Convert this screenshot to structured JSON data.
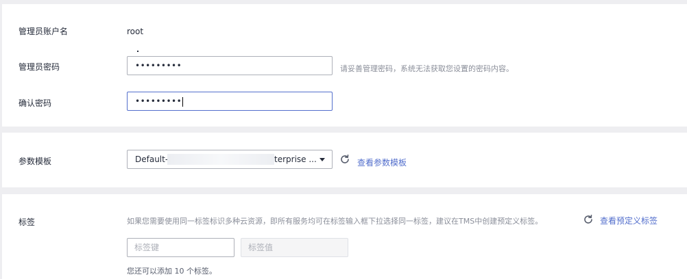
{
  "admin": {
    "account_label": "管理员账户名",
    "account_value": "root",
    "password_label": "管理员密码",
    "password_value": "•••••••••",
    "password_hint": "请妥善管理密码，系统无法获取您设置的密码内容。",
    "confirm_label": "确认密码",
    "confirm_value": "•••••••••"
  },
  "params": {
    "label": "参数模板",
    "selected_prefix": "Default-",
    "selected_suffix": "terprise ...",
    "refresh_icon": "refresh-icon",
    "view_link": "查看参数模板"
  },
  "tags": {
    "label": "标签",
    "hint": "如果您需要使用同一标签标识多种云资源，即所有服务均可在标签输入框下拉选择同一标签，建议在TMS中创建预定义标签。",
    "refresh_icon": "refresh-icon",
    "view_link": "查看预定义标签",
    "key_placeholder": "标签键",
    "value_placeholder": "标签值",
    "remaining_text": "您还可以添加 10 个标签。"
  },
  "colors": {
    "link": "#526ecc",
    "border": "#adb0b8",
    "focus_border": "#526ecc",
    "background": "#eeeef1"
  }
}
